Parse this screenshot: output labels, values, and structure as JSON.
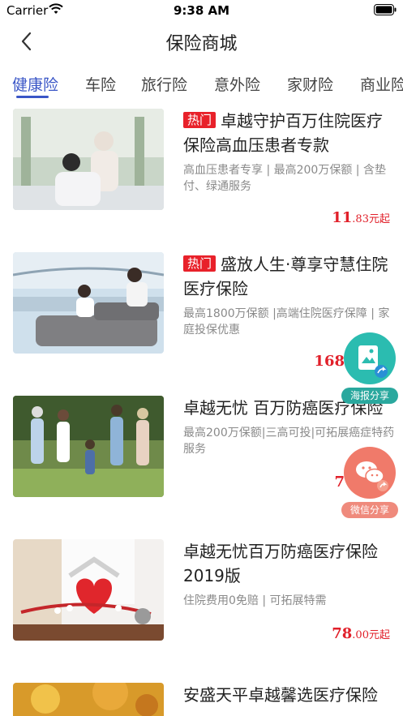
{
  "status_bar": {
    "carrier": "Carrier",
    "time": "9:38 AM"
  },
  "nav": {
    "title": "保险商城"
  },
  "tabs": [
    "健康险",
    "车险",
    "旅行险",
    "意外险",
    "家财险",
    "商业险"
  ],
  "products": [
    {
      "hot": "热门",
      "name": "卓越守护百万住院医疗保险高血压患者专款",
      "desc": "高血压患者专享 | 最高200万保额 | 含垫付、绿通服务",
      "price_int": "11",
      "price_frac": ".83",
      "price_unit": "元起"
    },
    {
      "hot": "热门",
      "name": "盛放人生·尊享守慧住院医疗保险",
      "desc": "最高1800万保额 |高端住院医疗保障 | 家庭投保优惠",
      "price_int": "168",
      "price_frac": "",
      "price_unit": ""
    },
    {
      "hot": "",
      "name": "卓越无忧 百万防癌医疗保险",
      "desc": "最高200万保额|三高可投|可拓展癌症特药服务",
      "price_int": "7",
      "price_frac": "",
      "price_unit": ""
    },
    {
      "hot": "",
      "name": "卓越无忧百万防癌医疗保险2019版",
      "desc": "住院费用0免赔 | 可拓展特需",
      "price_int": "78",
      "price_frac": ".00",
      "price_unit": "元起"
    },
    {
      "hot": "",
      "name": "安盛天平卓越馨选医疗保险",
      "desc": "",
      "price_int": "",
      "price_frac": "",
      "price_unit": ""
    }
  ],
  "share": {
    "poster_label": "海报分享",
    "wechat_label": "微信分享",
    "poster_icon": "poster-image-icon",
    "wechat_icon": "wechat-icon"
  },
  "colors": {
    "accent": "#3a56c7",
    "price": "#e1202a",
    "hot": "#e8212a",
    "poster": "#2bbcb0",
    "wechat": "#f07a6a"
  }
}
